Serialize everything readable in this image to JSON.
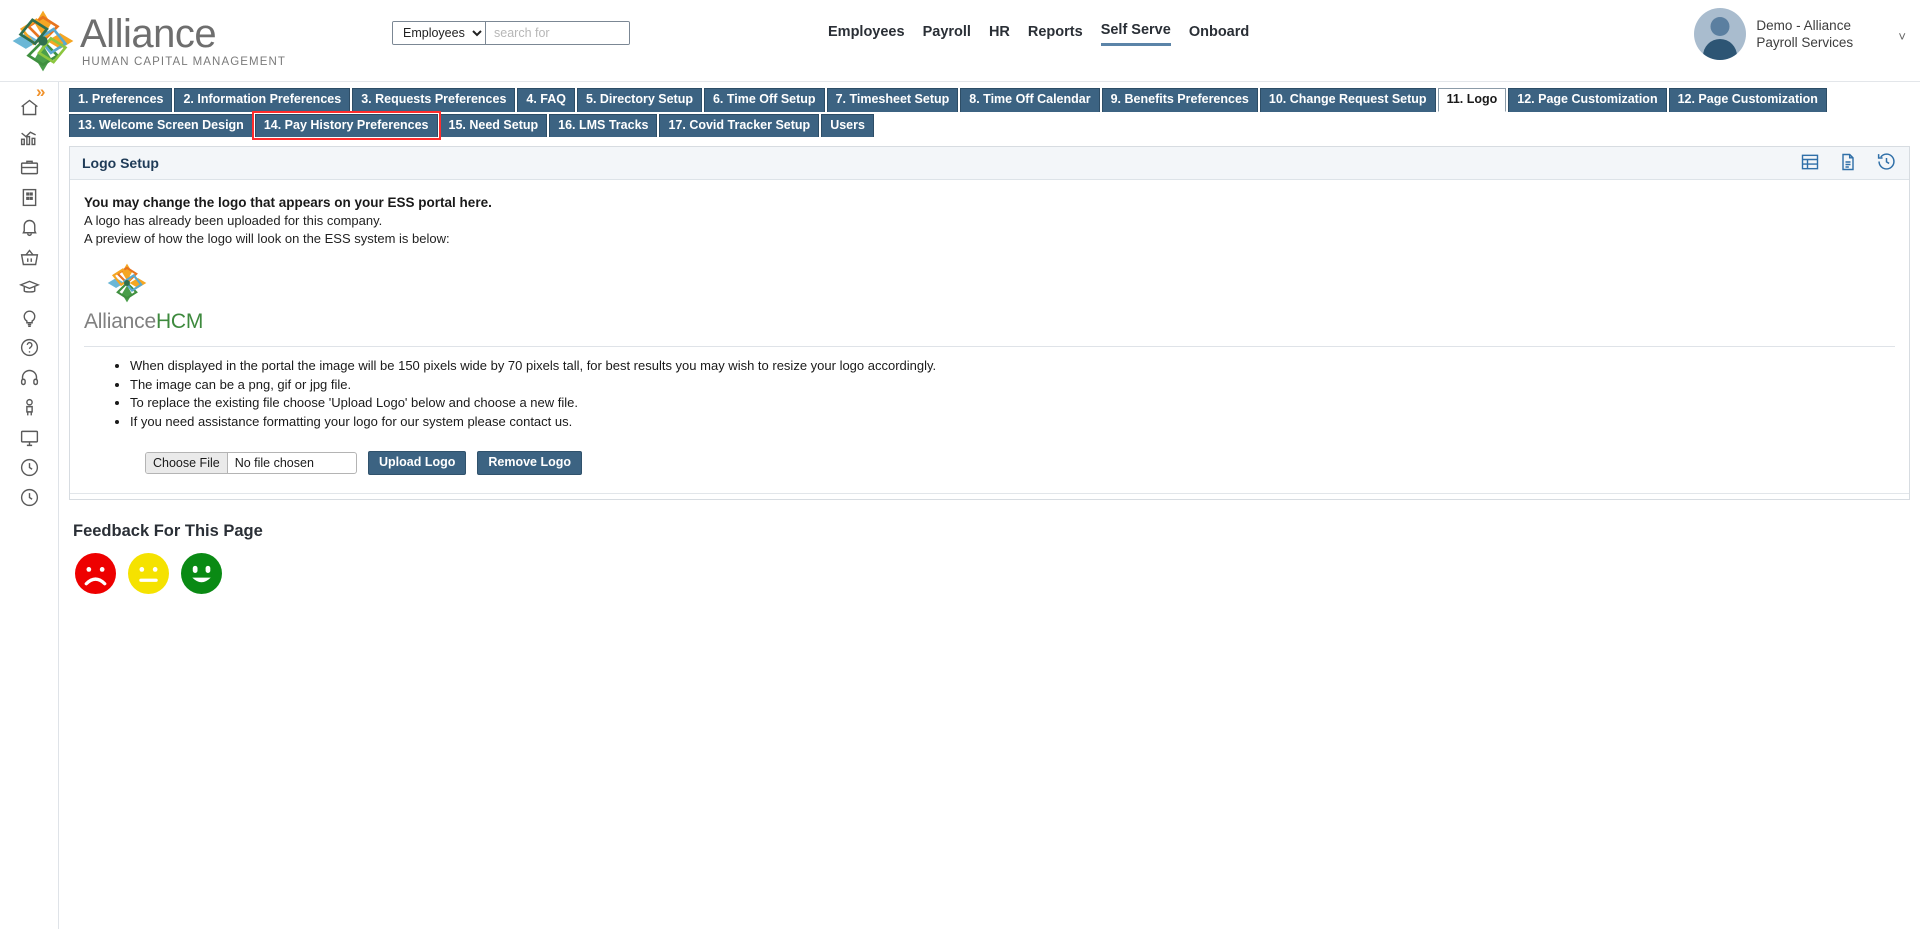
{
  "brand": {
    "name": "Alliance",
    "tagline": "HUMAN CAPITAL MANAGEMENT",
    "logo_icon": "alliance-star-logo"
  },
  "search": {
    "scope_selected": "Employees",
    "scope_options": [
      "Employees"
    ],
    "placeholder": "search for",
    "value": ""
  },
  "mainnav": {
    "items": [
      {
        "label": "Employees",
        "active": false
      },
      {
        "label": "Payroll",
        "active": false
      },
      {
        "label": "HR",
        "active": false
      },
      {
        "label": "Reports",
        "active": false
      },
      {
        "label": "Self Serve",
        "active": true
      },
      {
        "label": "Onboard",
        "active": false
      }
    ]
  },
  "user": {
    "name": "Demo - Alliance Payroll Services",
    "avatar_icon": "user-avatar-icon",
    "chevron_icon": "chevron-down-icon"
  },
  "sidebar": {
    "expander_icon": "chevron-right-icon",
    "items": [
      {
        "icon": "home-icon",
        "name": "home"
      },
      {
        "icon": "analytics-chart-icon",
        "name": "analytics"
      },
      {
        "icon": "briefcase-icon",
        "name": "briefcase"
      },
      {
        "icon": "building-icon",
        "name": "company"
      },
      {
        "icon": "bell-icon",
        "name": "notifications"
      },
      {
        "icon": "basket-icon",
        "name": "marketplace"
      },
      {
        "icon": "graduation-cap-icon",
        "name": "learning"
      },
      {
        "icon": "lightbulb-icon",
        "name": "ideas"
      },
      {
        "icon": "question-circle-icon",
        "name": "help"
      },
      {
        "icon": "headset-icon",
        "name": "support"
      },
      {
        "icon": "person-icon",
        "name": "profile"
      },
      {
        "icon": "monitor-icon",
        "name": "display"
      },
      {
        "icon": "clock-icon",
        "name": "time"
      },
      {
        "icon": "history-clock-icon",
        "name": "history"
      }
    ]
  },
  "tabs": {
    "row1": [
      {
        "label": "1. Preferences",
        "active": false,
        "highlighted": false
      },
      {
        "label": "2. Information Preferences",
        "active": false,
        "highlighted": false
      },
      {
        "label": "3. Requests Preferences",
        "active": false,
        "highlighted": false
      },
      {
        "label": "4. FAQ",
        "active": false,
        "highlighted": false
      },
      {
        "label": "5. Directory Setup",
        "active": false,
        "highlighted": false
      },
      {
        "label": "6. Time Off Setup",
        "active": false,
        "highlighted": false
      },
      {
        "label": "7. Timesheet Setup",
        "active": false,
        "highlighted": false
      },
      {
        "label": "8. Time Off Calendar",
        "active": false,
        "highlighted": false
      },
      {
        "label": "9. Benefits Preferences",
        "active": false,
        "highlighted": false
      },
      {
        "label": "10. Change Request Setup",
        "active": false,
        "highlighted": false
      },
      {
        "label": "11. Logo",
        "active": true,
        "highlighted": false
      },
      {
        "label": "12. Page Customization",
        "active": false,
        "highlighted": false
      },
      {
        "label": "12. Page Customization",
        "active": false,
        "highlighted": false
      }
    ],
    "row2": [
      {
        "label": "13. Welcome Screen Design",
        "active": false,
        "highlighted": false
      },
      {
        "label": "14. Pay History Preferences",
        "active": false,
        "highlighted": true
      },
      {
        "label": "15. Need Setup",
        "active": false,
        "highlighted": false
      },
      {
        "label": "16. LMS Tracks",
        "active": false,
        "highlighted": false
      },
      {
        "label": "17. Covid Tracker Setup",
        "active": false,
        "highlighted": false
      },
      {
        "label": "Users",
        "active": false,
        "highlighted": false
      }
    ]
  },
  "panel": {
    "title": "Logo Setup",
    "actions": [
      {
        "icon": "grid-table-icon",
        "name": "grid-view"
      },
      {
        "icon": "document-icon",
        "name": "document"
      },
      {
        "icon": "history-icon",
        "name": "history"
      }
    ],
    "intro_bold": "You may change the logo that appears on your ESS portal here.",
    "intro_lines": [
      "A logo has already been uploaded for this company.",
      "A preview of how the logo will look on the ESS system is below:"
    ],
    "preview_logo": {
      "icon": "alliance-star-logo",
      "text_primary": "Alliance",
      "text_secondary": "HCM"
    },
    "notes": [
      "When displayed in the portal the image will be 150 pixels wide by 70 pixels tall, for best results you may wish to resize your logo accordingly.",
      "The image can be a png, gif or jpg file.",
      "To replace the existing file choose 'Upload Logo' below and choose a new file.",
      "If you need assistance formatting your logo for our system please contact us."
    ],
    "file_input": {
      "button_label": "Choose File",
      "status_text": "No file chosen"
    },
    "upload_button": "Upload Logo",
    "remove_button": "Remove Logo"
  },
  "feedback": {
    "title": "Feedback For This Page",
    "faces": [
      {
        "name": "sad-face-icon",
        "color": "#ee0000",
        "mood": "negative"
      },
      {
        "name": "neutral-face-icon",
        "color": "#f5e200",
        "mood": "neutral"
      },
      {
        "name": "happy-face-icon",
        "color": "#0a8a14",
        "mood": "positive"
      }
    ]
  },
  "colors": {
    "tab_blue": "#3c6382",
    "nav_underline": "#5b84a8",
    "panel_title": "#1f3b57",
    "highlight_red": "#ff2d2d",
    "accent_orange": "#f0922b"
  }
}
